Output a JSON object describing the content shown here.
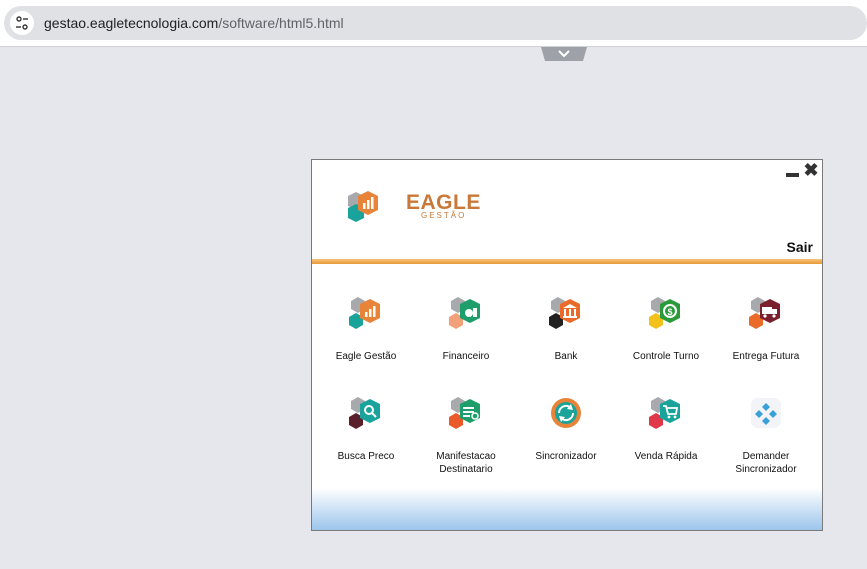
{
  "browser": {
    "url_host": "gestao.eagletecnologia.com",
    "url_path": "/software/html5.html",
    "site_icon": "tune-icon",
    "pull_tab_icon": "chevron-down-icon"
  },
  "window": {
    "minimize_icon": "minimize-icon",
    "close_icon": "close-icon",
    "close_glyph": "✖",
    "logo": {
      "text": "EAGLE",
      "subtitle": "GESTÃO"
    },
    "exit_label": "Sair"
  },
  "apps": [
    {
      "label": "Eagle Gestão",
      "icon": "chart-bars-icon",
      "color": "#e8843a"
    },
    {
      "label": "Financeiro",
      "icon": "money-bag-icon",
      "color": "#1e9e6a"
    },
    {
      "label": "Bank",
      "icon": "bank-icon",
      "color": "#ea6a2a"
    },
    {
      "label": "Controle Turno",
      "icon": "dollar-cycle-icon",
      "color": "#2a9a3a"
    },
    {
      "label": "Entrega Futura",
      "icon": "truck-icon",
      "color": "#7a1f2e"
    },
    {
      "label": "Busca Preco",
      "icon": "search-price-icon",
      "color": "#1aa39a"
    },
    {
      "label": "Manifestacao Destinatario",
      "icon": "document-check-icon",
      "color": "#1e9e6a"
    },
    {
      "label": "Sincronizador",
      "icon": "sync-icon",
      "color": "#e8843a"
    },
    {
      "label": "Venda Rápida",
      "icon": "cart-icon",
      "color": "#1aa39a"
    },
    {
      "label": "Demander Sincronizador",
      "icon": "demander-icon",
      "color": "#3aa0d8"
    }
  ],
  "colors": {
    "accent_orange": "#e79a36",
    "gradient_blue": "#9cc5ec"
  }
}
